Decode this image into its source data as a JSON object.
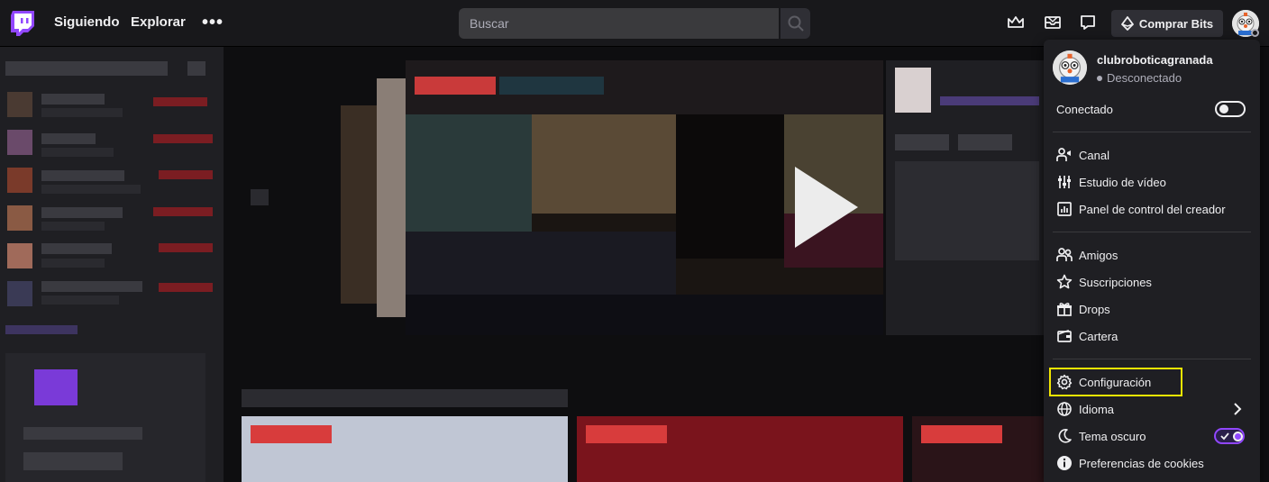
{
  "nav": {
    "following": "Siguiendo",
    "browse": "Explorar",
    "more": "•••",
    "search_placeholder": "Buscar",
    "get_bits": "Comprar Bits"
  },
  "menu": {
    "username": "clubroboticagranada",
    "status": "Desconectado",
    "online_label": "Conectado",
    "items_group1": [
      {
        "label": "Canal",
        "icon": "channel-icon"
      },
      {
        "label": "Estudio de vídeo",
        "icon": "video-studio-icon"
      },
      {
        "label": "Panel de control del creador",
        "icon": "dashboard-icon"
      }
    ],
    "items_group2": [
      {
        "label": "Amigos",
        "icon": "friends-icon"
      },
      {
        "label": "Suscripciones",
        "icon": "star-icon"
      },
      {
        "label": "Drops",
        "icon": "drops-icon"
      },
      {
        "label": "Cartera",
        "icon": "wallet-icon"
      }
    ],
    "items_group3": [
      {
        "label": "Configuración",
        "icon": "gear-icon"
      },
      {
        "label": "Idioma",
        "icon": "globe-icon"
      },
      {
        "label": "Tema oscuro",
        "icon": "moon-icon"
      },
      {
        "label": "Preferencias de cookies",
        "icon": "info-icon"
      }
    ]
  },
  "colors": {
    "brand": "#9147ff",
    "highlight": "#f2e600"
  }
}
